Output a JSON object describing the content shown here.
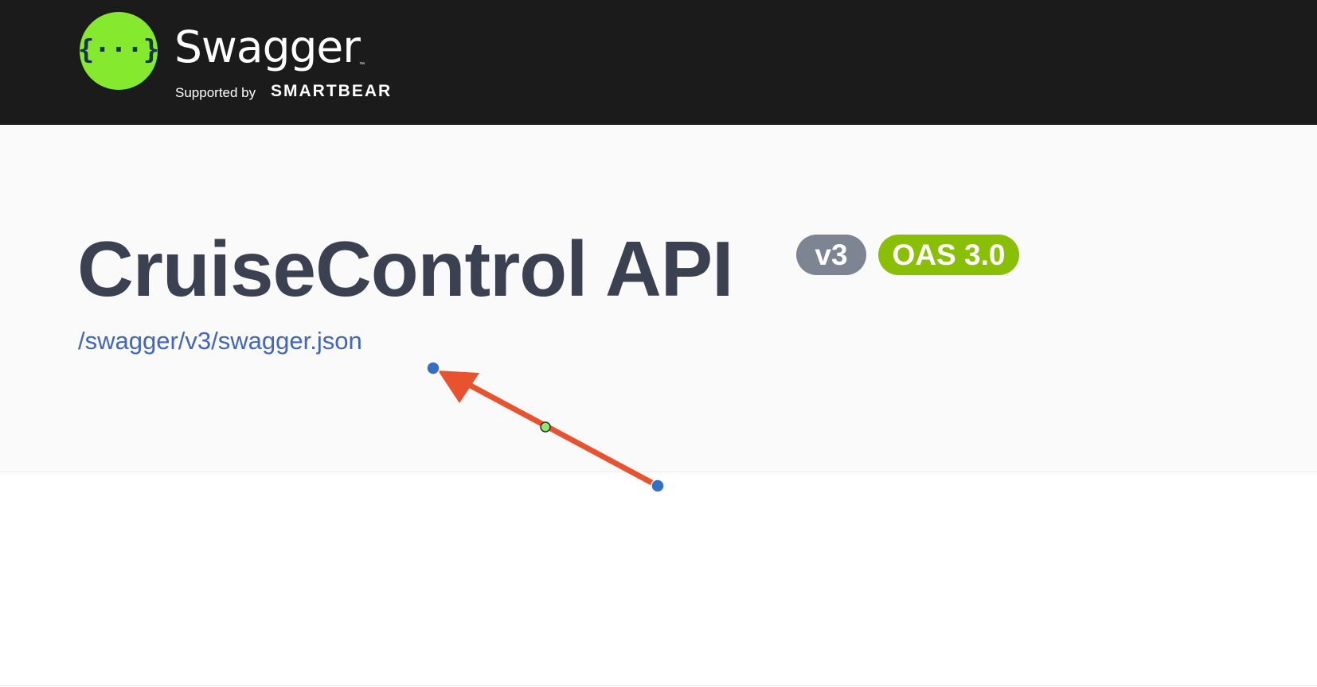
{
  "header": {
    "logo": {
      "wordmark": "Swagger",
      "trademark": "™",
      "supported_by": "Supported by",
      "company": "SMARTBEAR",
      "icon_glyph": "{···}",
      "icon": "swagger-braces-icon",
      "circle_color": "#85ea2d"
    }
  },
  "info": {
    "title": "CruiseControl API",
    "version_badge": "v3",
    "oas_badge": "OAS 3.0",
    "spec_url": "/swagger/v3/swagger.json"
  },
  "annotation": {
    "type": "arrow",
    "color": "#e8522e",
    "handle_color": "#3370c4",
    "midpoint_color": "#8ee86b"
  }
}
